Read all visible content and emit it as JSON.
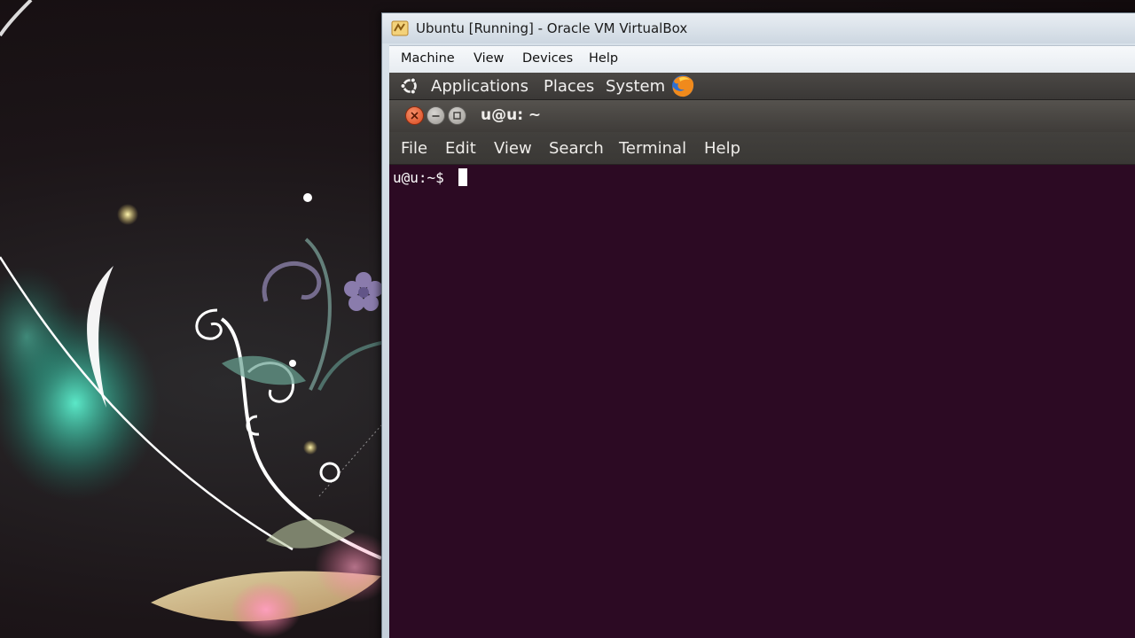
{
  "vbox": {
    "title": "Ubuntu [Running] - Oracle VM VirtualBox",
    "menu": [
      "Machine",
      "View",
      "Devices",
      "Help"
    ]
  },
  "guest_panel": {
    "menus": [
      "Applications",
      "Places",
      "System"
    ],
    "icons": [
      "ubuntu-logo",
      "firefox"
    ]
  },
  "terminal": {
    "title": "u@u: ~",
    "menu": [
      "File",
      "Edit",
      "View",
      "Search",
      "Terminal",
      "Help"
    ],
    "prompt": "u@u:~$ "
  },
  "colors": {
    "terminal_background": "#2c0a23",
    "panel_background": "#3a3836",
    "close_button": "#d9481e"
  }
}
